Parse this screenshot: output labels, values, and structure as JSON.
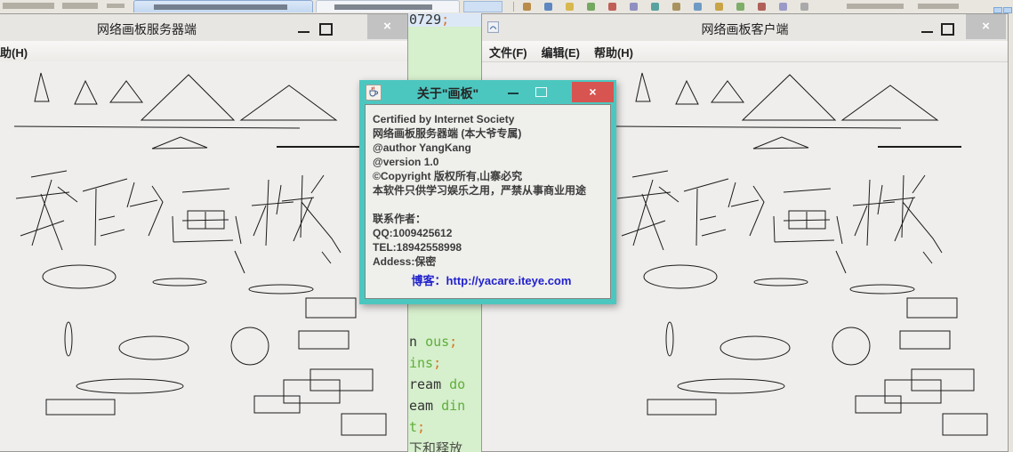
{
  "background": {
    "toolbar_icons": [
      "#b98c4a",
      "#5f87c0",
      "#d8b84e",
      "#74a860",
      "#c05f57",
      "#8f8fc2",
      "#58a3a0",
      "#a8935f",
      "#6f9bc4",
      "#c9a347",
      "#7fae6a",
      "#b06058",
      "#9a9ac8",
      "#a9a9a9"
    ]
  },
  "eclipse": {
    "selected_line": [
      [
        "0729",
        "plain"
      ],
      [
        ";",
        "orange"
      ]
    ],
    "code_lines": [
      [
        [
          "n ",
          "plain"
        ],
        [
          "ous",
          "green"
        ],
        [
          ";",
          "orange"
        ]
      ],
      [
        [
          "ins",
          "green"
        ],
        [
          ";",
          "orange"
        ]
      ],
      [
        [
          "ream ",
          "plain"
        ],
        [
          "do",
          "green"
        ]
      ],
      [
        [
          "eam ",
          "plain"
        ],
        [
          "din",
          "green"
        ]
      ],
      [
        [
          "t",
          "green"
        ],
        [
          ";",
          "orange"
        ]
      ],
      [
        [
          "下和释放",
          "comment"
        ]
      ]
    ]
  },
  "server_window": {
    "title": "网络画板服务器端",
    "menu_fragment": "助(H)"
  },
  "client_window": {
    "title": "网络画板客户端",
    "menus": [
      "文件(F)",
      "编辑(E)",
      "帮助(H)"
    ]
  },
  "dialog": {
    "title": "关于\"画板\"",
    "lines": [
      "Certified by Internet Society",
      "网络画板服务器端 (本大爷专属)",
      "@author YangKang",
      "@version 1.0",
      "©Copyright 版权所有,山寨必究",
      "本软件只供学习娱乐之用，严禁从事商业用途",
      "",
      "联系作者：",
      "QQ:1009425612",
      "TEL:18942558998",
      "Addess:保密"
    ],
    "link": "博客：http://yacare.iteye.com"
  },
  "icons": {
    "close_glyph": "×"
  },
  "colors": {
    "dialog_teal": "#4cc7c0",
    "dialog_close_red": "#d85450",
    "code_background": "#d6efcd",
    "selected_line_background": "#dce8f6",
    "link_blue": "#2121cc"
  }
}
